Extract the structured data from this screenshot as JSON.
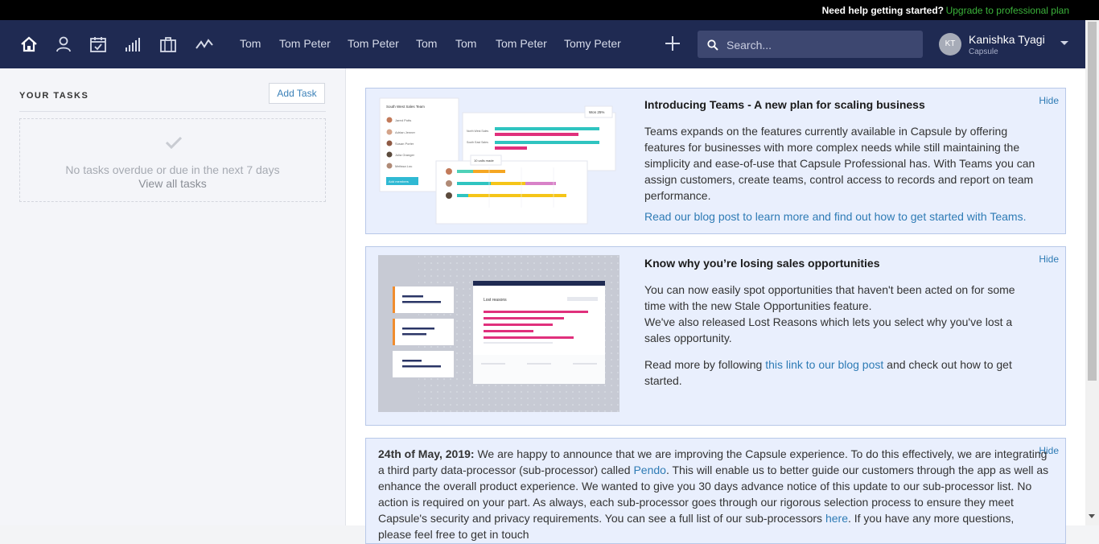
{
  "topbar": {
    "help_text": "Need help getting started?",
    "upgrade_link": "Upgrade to professional plan"
  },
  "nav": {
    "icons": [
      "home-icon",
      "person-icon",
      "calendar-icon",
      "bar-chart-icon",
      "briefcase-icon",
      "activity-icon"
    ],
    "tabs": [
      "Tom",
      "Tom Peter",
      "Tom Peter",
      "Tom",
      "Tom",
      "Tom Peter",
      "Tomy Peter"
    ],
    "search_placeholder": "Search...",
    "user": {
      "initials": "KT",
      "name": "Kanishka Tyagi",
      "org": "Capsule"
    }
  },
  "sidebar": {
    "title": "YOUR TASKS",
    "add_task": "Add Task",
    "empty_message": "No tasks overdue or due in the next 7 days",
    "view_all": "View all tasks"
  },
  "cards": [
    {
      "title": "Introducing Teams - A new plan for scaling business",
      "hide": "Hide",
      "body": "Teams expands on the features currently available in Capsule by offering features for businesses with more complex needs while still maintaining the simplicity and ease-of-use that Capsule Professional has. With Teams you can assign customers, create teams, control access to records and report on team performance.",
      "link": "Read our blog post to learn more and find out how to get started with Teams."
    },
    {
      "title": "Know why you’re losing sales opportunities",
      "hide": "Hide",
      "body1": "You can now easily spot opportunities that haven't been acted on for some time with the new Stale Opportunities feature.",
      "body2": "We've also released Lost Reasons which lets you select why you've lost a sales opportunity.",
      "body3_prefix": "Read more by following ",
      "body3_link": "this link to our blog post",
      "body3_suffix": " and check out how to get started."
    },
    {
      "hide": "Hide",
      "date": "24th of May, 2019:",
      "text1": " We are happy to announce that we are improving the Capsule experience. To do this effectively, we are integrating a third party data-processor (sub-processor) called ",
      "link1": "Pendo",
      "text2": ". This will enable us to better guide our customers through the app as well as enhance the overall product experience. We wanted to give you 30 days advance notice of this update to our sub-processor list. No action is required on your part. As always, each sub-processor goes through our rigorous selection process to ensure they meet Capsule's security and privacy requirements. You can see a full list of our sub-processors ",
      "link2": "here",
      "text3": ". If you have any more questions, please feel free to get in touch"
    }
  ],
  "illustration1": {
    "team_title": "South West Sales Team",
    "members": [
      "Jared Potts",
      "Adrian Jenner",
      "Susan Porter",
      "Julia Granger",
      "Melissa Lou"
    ],
    "add_members": "Add members",
    "badge": "Won 25%",
    "rows": [
      "North West Sales",
      "South East Sales"
    ],
    "calls": "10 calls made"
  },
  "illustration2": {
    "panel_title": "Lost reasons"
  },
  "colors": {
    "nav_bg": "#1f2a52",
    "card_bg": "#e9effd",
    "link": "#2e7bb5",
    "upgrade": "#3bb33b"
  }
}
